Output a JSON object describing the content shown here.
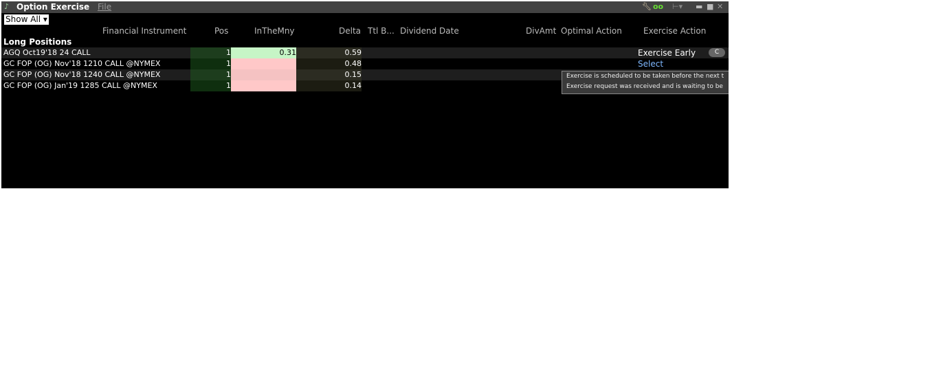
{
  "window": {
    "title": "Option Exercise",
    "menu_file": "File"
  },
  "filter": {
    "value": "Show All"
  },
  "columns": [
    "Financial Instrument",
    "Pos",
    "InTheMny",
    "Delta",
    "Ttl B...",
    "Dividend Date",
    "DivAmt",
    "Optimal Action",
    "Exercise Action"
  ],
  "group_label": "Long Positions",
  "rows": [
    {
      "instrument": "AGQ Oct19'18 24 CALL",
      "pos": "1",
      "inthemny": "0.31",
      "delta": "0.59",
      "exercise_action": "Exercise Early",
      "button": "C"
    },
    {
      "instrument": "GC FOP (OG) Nov'18 1210 CALL @NYMEX",
      "pos": "1",
      "inthemny": "",
      "delta": "0.48",
      "exercise_action": "Select"
    },
    {
      "instrument": "GC FOP (OG) Nov'18 1240 CALL @NYMEX",
      "pos": "1",
      "inthemny": "",
      "delta": "0.15",
      "exercise_action": ""
    },
    {
      "instrument": "GC FOP (OG) Jan'19 1285 CALL @NYMEX",
      "pos": "1",
      "inthemny": "",
      "delta": "0.14",
      "exercise_action": ""
    }
  ],
  "tooltip": {
    "line1": "Exercise is scheduled to be taken before the next t",
    "line2": "Exercise request was received and is waiting to be"
  },
  "colors": {
    "itm_positive": "#c6f5c6",
    "itm_negative": "#ffc8c8",
    "pos_bg": "#0f3a0f",
    "select_link": "#7fb8ff"
  }
}
